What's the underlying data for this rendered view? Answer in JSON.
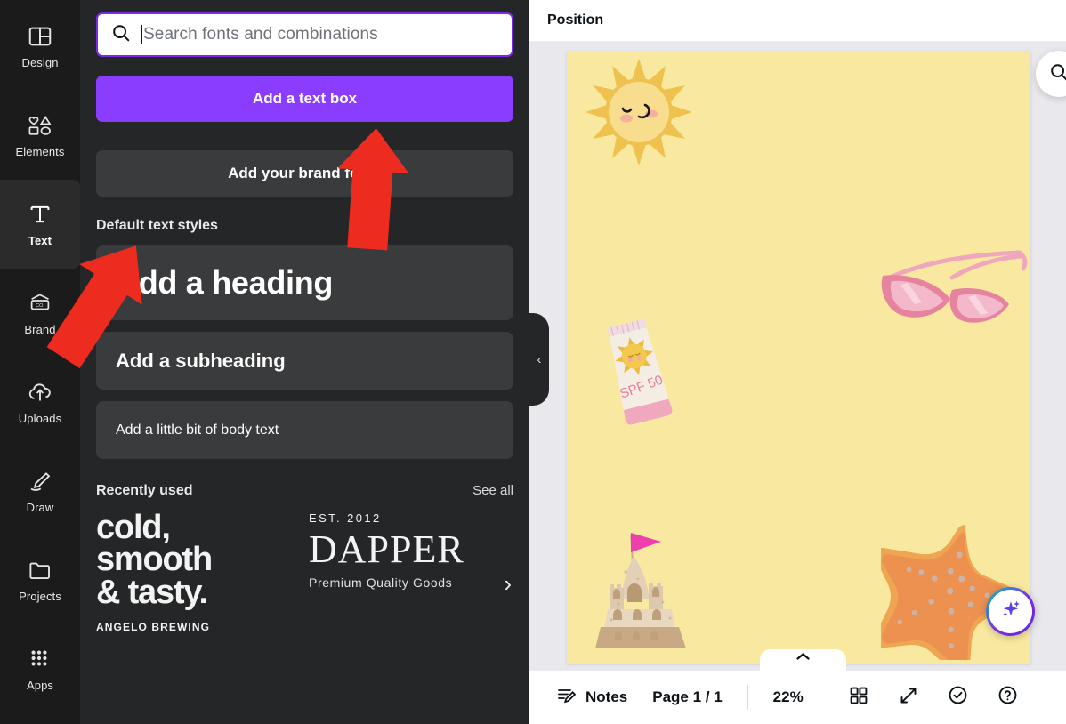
{
  "sidebar": {
    "items": [
      {
        "label": "Design",
        "icon": "design-icon",
        "active": false
      },
      {
        "label": "Elements",
        "icon": "elements-icon",
        "active": false
      },
      {
        "label": "Text",
        "icon": "text-icon",
        "active": true
      },
      {
        "label": "Brand",
        "icon": "brand-icon",
        "active": false
      },
      {
        "label": "Uploads",
        "icon": "uploads-icon",
        "active": false
      },
      {
        "label": "Draw",
        "icon": "draw-icon",
        "active": false
      },
      {
        "label": "Projects",
        "icon": "projects-icon",
        "active": false
      },
      {
        "label": "Apps",
        "icon": "apps-icon",
        "active": false
      }
    ]
  },
  "panel": {
    "search": {
      "placeholder": "Search fonts and combinations",
      "value": "",
      "icon": "search-icon"
    },
    "add_text_box_label": "Add a text box",
    "add_brand_fonts_label": "Add your brand fonts",
    "default_styles_title": "Default text styles",
    "styles": [
      {
        "label": "Add a heading"
      },
      {
        "label": "Add a subheading"
      },
      {
        "label": "Add a little bit of body text"
      }
    ],
    "recently_used_title": "Recently used",
    "see_all_label": "See all",
    "combinations": [
      {
        "line1": "cold,",
        "line2": "smooth",
        "line3": "& tasty.",
        "caption": "ANGELO BREWING"
      },
      {
        "est": "EST. 2012",
        "name": "DAPPER",
        "tagline": "Premium Quality Goods"
      }
    ],
    "next_arrow_icon": "chevron-right-icon",
    "collapse_icon": "chevron-left-icon"
  },
  "topbar": {
    "title": "Position"
  },
  "canvas": {
    "background_color": "#F9E9A0",
    "elements": [
      {
        "name": "sun-illustration",
        "label": "Smiling sun"
      },
      {
        "name": "sunglasses-illustration",
        "label": "Pink cat-eye sunglasses"
      },
      {
        "name": "sunscreen-illustration",
        "label": "Sunscreen tube",
        "text": "SPF 50"
      },
      {
        "name": "sandcastle-illustration",
        "label": "Sandcastle with pink flag"
      },
      {
        "name": "starfish-illustration",
        "label": "Orange starfish"
      }
    ],
    "search_fab_icon": "search-icon",
    "magic_fab_icon": "sparkle-icon",
    "page_tab_icon": "chevron-up-icon"
  },
  "bottombar": {
    "notes_label": "Notes",
    "notes_icon": "notes-pencil-icon",
    "page_label": "Page 1 / 1",
    "zoom_label": "22%",
    "grid_icon": "grid-view-icon",
    "fullscreen_icon": "expand-icon",
    "status_icon": "check-circle-icon",
    "help_icon": "help-circle-icon"
  },
  "annotations": [
    {
      "name": "arrow-to-add-text-box",
      "color": "#EE2B1F",
      "points_at": "Add a text box"
    },
    {
      "name": "arrow-to-text-tab",
      "color": "#EE2B1F",
      "points_at": "Text"
    }
  ]
}
